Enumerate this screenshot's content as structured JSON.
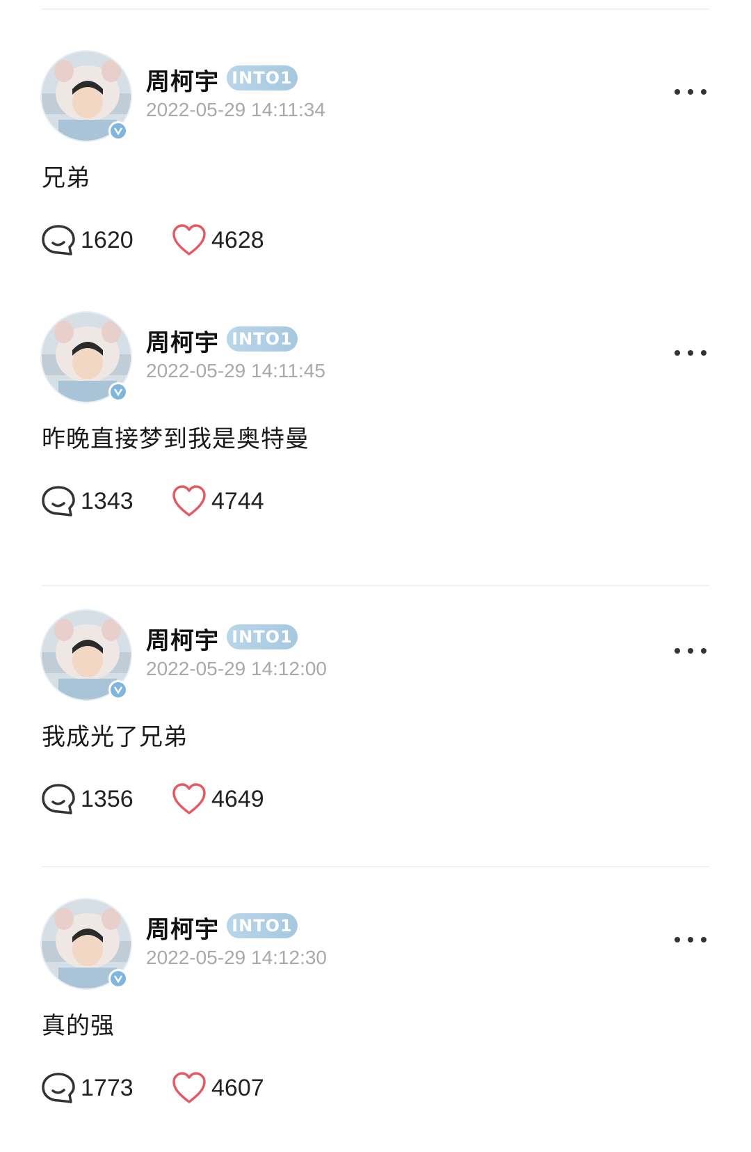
{
  "posts": [
    {
      "username": "周柯宇",
      "group_badge": "INTO1",
      "timestamp": "2022-05-29 14:11:34",
      "text": "兄弟",
      "comments": "1620",
      "likes": "4628"
    },
    {
      "username": "周柯宇",
      "group_badge": "INTO1",
      "timestamp": "2022-05-29 14:11:45",
      "text": "昨晚直接梦到我是奥特曼",
      "comments": "1343",
      "likes": "4744"
    },
    {
      "username": "周柯宇",
      "group_badge": "INTO1",
      "timestamp": "2022-05-29 14:12:00",
      "text": "我成光了兄弟",
      "comments": "1356",
      "likes": "4649"
    },
    {
      "username": "周柯宇",
      "group_badge": "INTO1",
      "timestamp": "2022-05-29 14:12:30",
      "text": "真的强",
      "comments": "1773",
      "likes": "4607"
    }
  ],
  "icons": {
    "comment": "comment-bubble-icon",
    "like": "heart-icon",
    "more": "more-dots-icon",
    "verified": "verified-badge-icon"
  },
  "colors": {
    "heart": "#e45a61",
    "badge": "#a9cbe3",
    "timestamp": "#a9a9a9"
  }
}
